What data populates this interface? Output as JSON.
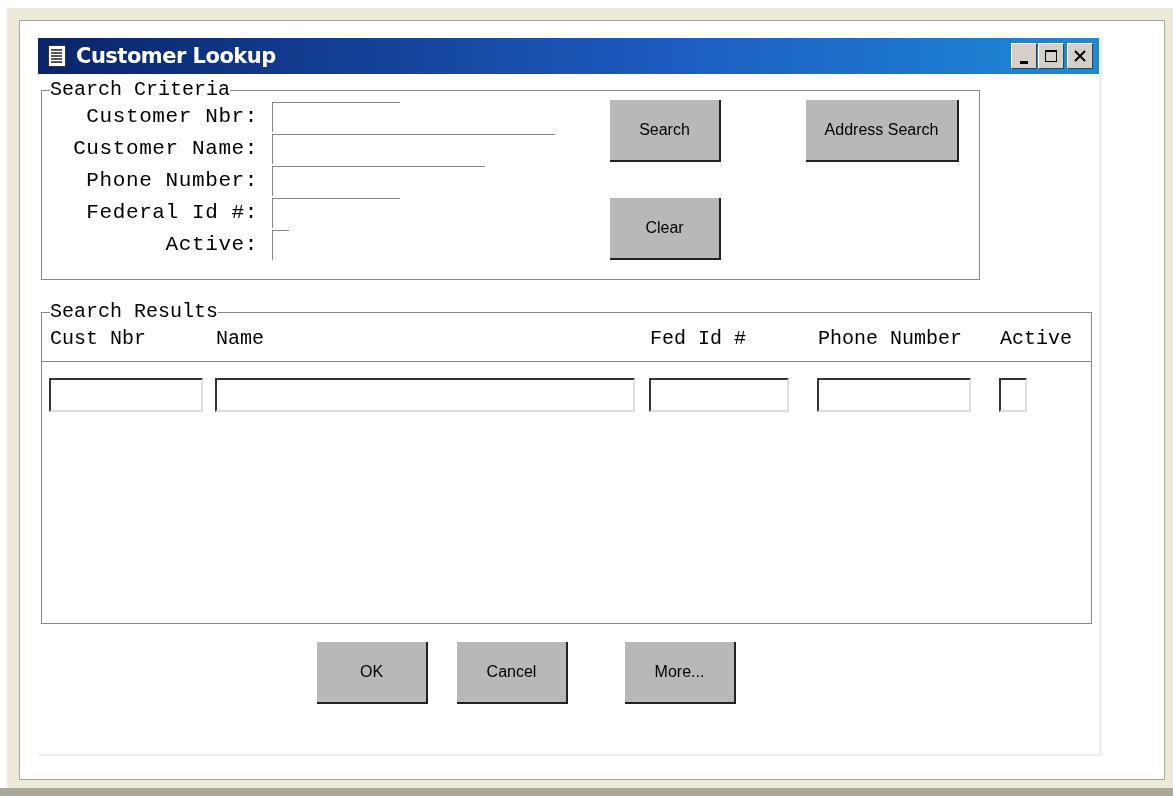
{
  "window": {
    "title": "Customer Lookup"
  },
  "criteria": {
    "legend": "Search Criteria",
    "fields": [
      {
        "label": "Customer Nbr:",
        "kind": "text"
      },
      {
        "label": "Customer Name:",
        "kind": "text"
      },
      {
        "label": "Phone Number:",
        "kind": "text"
      },
      {
        "label": "Federal Id #:",
        "kind": "text"
      },
      {
        "label": "Active:",
        "kind": "check",
        "checked": false
      }
    ],
    "buttons": [
      "Search",
      "Address Search",
      "Clear"
    ]
  },
  "results": {
    "legend": "Search Results",
    "columns": [
      "Cust Nbr",
      "Name",
      "Fed Id #",
      "Phone Number",
      "Active"
    ]
  },
  "buttons": [
    "OK",
    "Cancel",
    "More..."
  ]
}
